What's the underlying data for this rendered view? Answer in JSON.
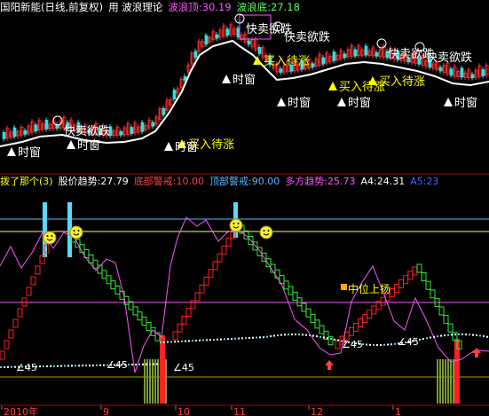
{
  "window": {
    "title_stock": "国阳新能(日线,前复权)",
    "title_indicator_name": "用 波浪理论",
    "colors": {
      "background": "#000000",
      "title": "#ffffff"
    }
  },
  "main_panel": {
    "legend": [
      {
        "label": "波浪顶",
        "value": "30.19",
        "color": "#ff55ff"
      },
      {
        "label": "波浪底",
        "value": "27.18",
        "color": "#55ff55"
      }
    ],
    "annotations": [
      {
        "text": "快卖欲跌",
        "color": "#ffffff"
      },
      {
        "text": "快卖欲跌",
        "color": "#ffffff"
      },
      {
        "text": "快卖欲跌",
        "color": "#ffffff"
      },
      {
        "text": "快卖欲跌",
        "color": "#ffffff"
      },
      {
        "text": "快卖欲跌",
        "color": "#ffffff"
      },
      {
        "text": "买入待涨",
        "color": "#ffff00"
      },
      {
        "text": "买入待涨",
        "color": "#ffff00"
      },
      {
        "text": "买入待涨",
        "color": "#ffff00"
      },
      {
        "text": "买入待涨",
        "color": "#ffff00"
      },
      {
        "text": "时窗",
        "color": "#ffffff"
      },
      {
        "text": "时窗",
        "color": "#ffffff"
      },
      {
        "text": "时窗",
        "color": "#ffffff"
      },
      {
        "text": "时窗",
        "color": "#ffffff"
      },
      {
        "text": "时窗",
        "color": "#ffffff"
      },
      {
        "text": "时窗",
        "color": "#ffffff"
      },
      {
        "text": "时窗",
        "color": "#ffffff"
      }
    ]
  },
  "indicator_panel": {
    "legend": [
      {
        "label": "拨了那个(3)",
        "value": "",
        "color": "#ffff00"
      },
      {
        "label": "股价趋势:",
        "value": "27.79",
        "color": "#ffffff"
      },
      {
        "label": "底部警戒:",
        "value": "10.00",
        "color": "#ff4040"
      },
      {
        "label": "顶部警戒:",
        "value": "90.00",
        "color": "#5ab4ff"
      },
      {
        "label": "多方趋势:",
        "value": "25.73",
        "color": "#ff55ff"
      },
      {
        "label": "A4:",
        "value": "24.31",
        "color": "#ffffff"
      },
      {
        "label": "A5:",
        "value": "23",
        "color": "#3f6bff"
      }
    ],
    "annotations": [
      {
        "text": "中位上扬",
        "color": "#ffff00"
      },
      {
        "text": "∠45",
        "color": "#ffffff"
      },
      {
        "text": "∠45",
        "color": "#ffffff"
      },
      {
        "text": "∠45",
        "color": "#ffffff"
      },
      {
        "text": "∠45",
        "color": "#ffffff"
      },
      {
        "text": "∠45",
        "color": "#ffffff"
      }
    ]
  },
  "date_axis": {
    "labels": [
      "2010年",
      "9",
      "10",
      "11",
      "12",
      "1"
    ],
    "color": "#ff4040"
  }
}
